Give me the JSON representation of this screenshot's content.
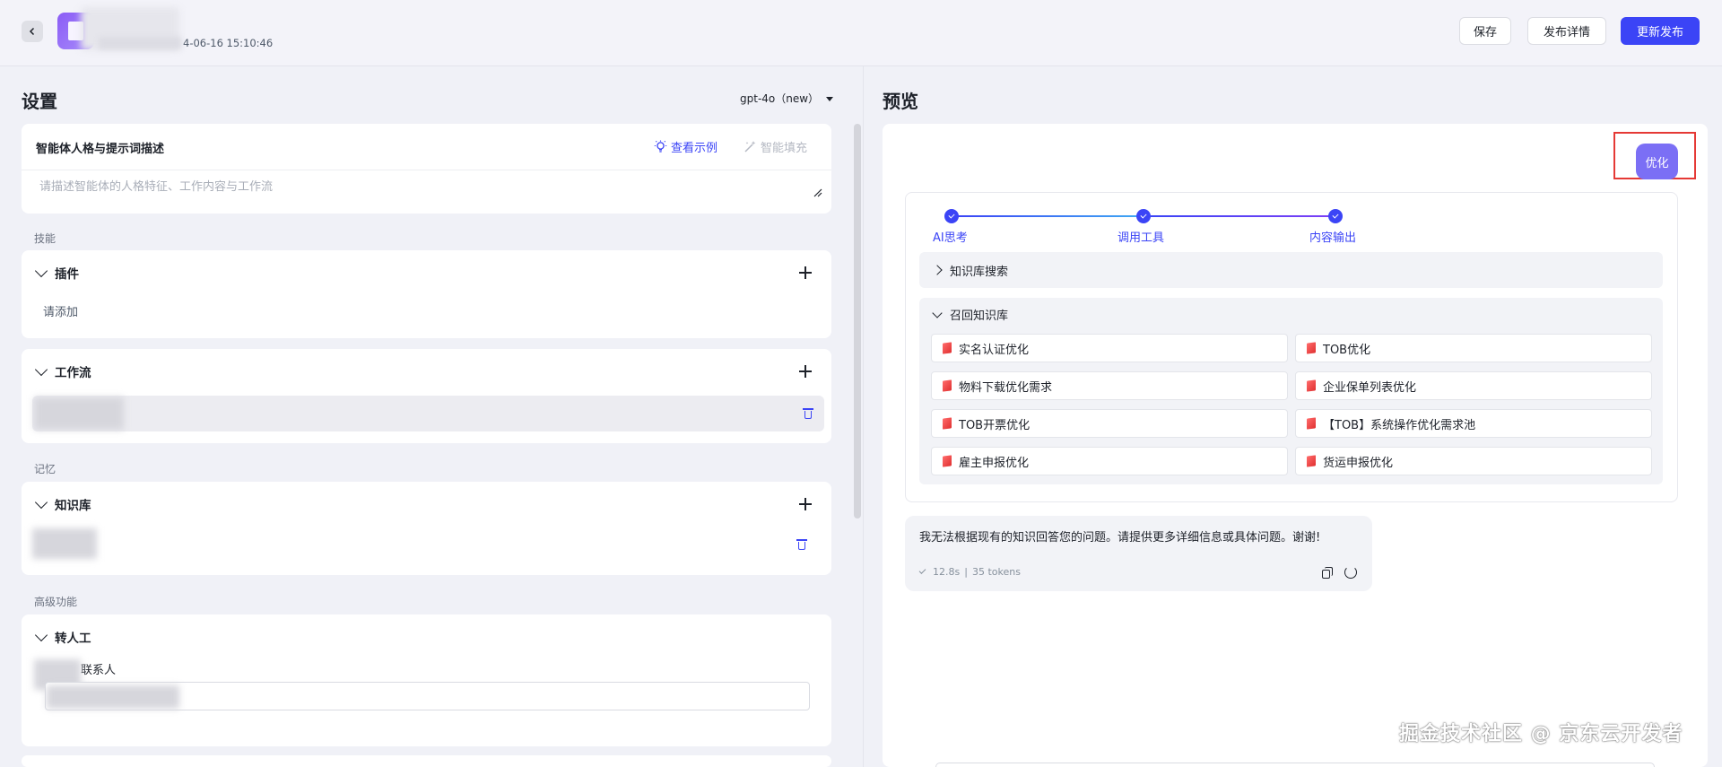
{
  "header": {
    "meta_time": "4-06-16 15:10:46",
    "save_label": "保存",
    "publish_detail_label": "发布详情",
    "update_publish_label": "更新发布"
  },
  "settings": {
    "title": "设置",
    "model": "gpt-4o（new）",
    "prompt": {
      "title": "智能体人格与提示词描述",
      "view_example": "查看示例",
      "smart_fill": "智能填充",
      "placeholder": "请描述智能体的人格特征、工作内容与工作流"
    },
    "skills_label": "技能",
    "plugin": {
      "title": "插件",
      "empty_text": "请添加"
    },
    "workflow": {
      "title": "工作流"
    },
    "memory_label": "记忆",
    "knowledge": {
      "title": "知识库"
    },
    "advanced_label": "高级功能",
    "handoff": {
      "title": "转人工",
      "contact_label": "联系人"
    }
  },
  "preview": {
    "title": "预览",
    "optimize_label": "优化",
    "steps": [
      "AI思考",
      "调用工具",
      "内容输出"
    ],
    "kb_search_label": "知识库搜索",
    "kb_recall_label": "召回知识库",
    "docs": [
      "实名认证优化",
      "TOB优化",
      "物料下载优化需求",
      "企业保单列表优化",
      "TOB开票优化",
      "【TOB】系统操作优化需求池",
      "雇主申报优化",
      "货运申报优化"
    ],
    "answer": {
      "text": "我无法根据现有的知识回答您的问题。请提供更多详细信息或具体问题。谢谢!",
      "duration": "12.8s",
      "separator": "|",
      "tokens": "35 tokens"
    }
  },
  "watermark_text": "掘金技术社区 @ 京东云开发者",
  "colors": {
    "accent": "#3b44f6",
    "optimize": "#7b6ff5",
    "highlight_border": "#e53935"
  }
}
